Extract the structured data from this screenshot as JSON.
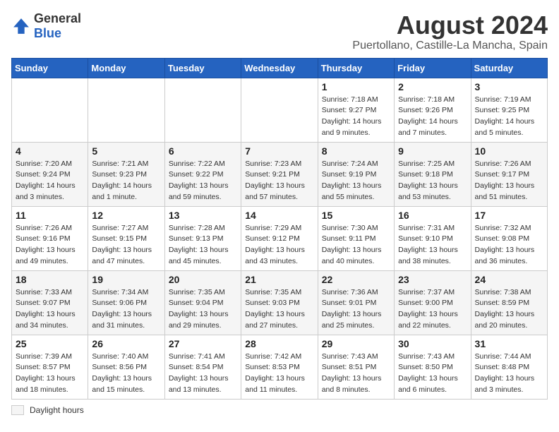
{
  "logo": {
    "general": "General",
    "blue": "Blue"
  },
  "title": "August 2024",
  "subtitle": "Puertollano, Castille-La Mancha, Spain",
  "headers": [
    "Sunday",
    "Monday",
    "Tuesday",
    "Wednesday",
    "Thursday",
    "Friday",
    "Saturday"
  ],
  "weeks": [
    [
      {
        "day": "",
        "info": ""
      },
      {
        "day": "",
        "info": ""
      },
      {
        "day": "",
        "info": ""
      },
      {
        "day": "",
        "info": ""
      },
      {
        "day": "1",
        "info": "Sunrise: 7:18 AM\nSunset: 9:27 PM\nDaylight: 14 hours\nand 9 minutes."
      },
      {
        "day": "2",
        "info": "Sunrise: 7:18 AM\nSunset: 9:26 PM\nDaylight: 14 hours\nand 7 minutes."
      },
      {
        "day": "3",
        "info": "Sunrise: 7:19 AM\nSunset: 9:25 PM\nDaylight: 14 hours\nand 5 minutes."
      }
    ],
    [
      {
        "day": "4",
        "info": "Sunrise: 7:20 AM\nSunset: 9:24 PM\nDaylight: 14 hours\nand 3 minutes."
      },
      {
        "day": "5",
        "info": "Sunrise: 7:21 AM\nSunset: 9:23 PM\nDaylight: 14 hours\nand 1 minute."
      },
      {
        "day": "6",
        "info": "Sunrise: 7:22 AM\nSunset: 9:22 PM\nDaylight: 13 hours\nand 59 minutes."
      },
      {
        "day": "7",
        "info": "Sunrise: 7:23 AM\nSunset: 9:21 PM\nDaylight: 13 hours\nand 57 minutes."
      },
      {
        "day": "8",
        "info": "Sunrise: 7:24 AM\nSunset: 9:19 PM\nDaylight: 13 hours\nand 55 minutes."
      },
      {
        "day": "9",
        "info": "Sunrise: 7:25 AM\nSunset: 9:18 PM\nDaylight: 13 hours\nand 53 minutes."
      },
      {
        "day": "10",
        "info": "Sunrise: 7:26 AM\nSunset: 9:17 PM\nDaylight: 13 hours\nand 51 minutes."
      }
    ],
    [
      {
        "day": "11",
        "info": "Sunrise: 7:26 AM\nSunset: 9:16 PM\nDaylight: 13 hours\nand 49 minutes."
      },
      {
        "day": "12",
        "info": "Sunrise: 7:27 AM\nSunset: 9:15 PM\nDaylight: 13 hours\nand 47 minutes."
      },
      {
        "day": "13",
        "info": "Sunrise: 7:28 AM\nSunset: 9:13 PM\nDaylight: 13 hours\nand 45 minutes."
      },
      {
        "day": "14",
        "info": "Sunrise: 7:29 AM\nSunset: 9:12 PM\nDaylight: 13 hours\nand 43 minutes."
      },
      {
        "day": "15",
        "info": "Sunrise: 7:30 AM\nSunset: 9:11 PM\nDaylight: 13 hours\nand 40 minutes."
      },
      {
        "day": "16",
        "info": "Sunrise: 7:31 AM\nSunset: 9:10 PM\nDaylight: 13 hours\nand 38 minutes."
      },
      {
        "day": "17",
        "info": "Sunrise: 7:32 AM\nSunset: 9:08 PM\nDaylight: 13 hours\nand 36 minutes."
      }
    ],
    [
      {
        "day": "18",
        "info": "Sunrise: 7:33 AM\nSunset: 9:07 PM\nDaylight: 13 hours\nand 34 minutes."
      },
      {
        "day": "19",
        "info": "Sunrise: 7:34 AM\nSunset: 9:06 PM\nDaylight: 13 hours\nand 31 minutes."
      },
      {
        "day": "20",
        "info": "Sunrise: 7:35 AM\nSunset: 9:04 PM\nDaylight: 13 hours\nand 29 minutes."
      },
      {
        "day": "21",
        "info": "Sunrise: 7:35 AM\nSunset: 9:03 PM\nDaylight: 13 hours\nand 27 minutes."
      },
      {
        "day": "22",
        "info": "Sunrise: 7:36 AM\nSunset: 9:01 PM\nDaylight: 13 hours\nand 25 minutes."
      },
      {
        "day": "23",
        "info": "Sunrise: 7:37 AM\nSunset: 9:00 PM\nDaylight: 13 hours\nand 22 minutes."
      },
      {
        "day": "24",
        "info": "Sunrise: 7:38 AM\nSunset: 8:59 PM\nDaylight: 13 hours\nand 20 minutes."
      }
    ],
    [
      {
        "day": "25",
        "info": "Sunrise: 7:39 AM\nSunset: 8:57 PM\nDaylight: 13 hours\nand 18 minutes."
      },
      {
        "day": "26",
        "info": "Sunrise: 7:40 AM\nSunset: 8:56 PM\nDaylight: 13 hours\nand 15 minutes."
      },
      {
        "day": "27",
        "info": "Sunrise: 7:41 AM\nSunset: 8:54 PM\nDaylight: 13 hours\nand 13 minutes."
      },
      {
        "day": "28",
        "info": "Sunrise: 7:42 AM\nSunset: 8:53 PM\nDaylight: 13 hours\nand 11 minutes."
      },
      {
        "day": "29",
        "info": "Sunrise: 7:43 AM\nSunset: 8:51 PM\nDaylight: 13 hours\nand 8 minutes."
      },
      {
        "day": "30",
        "info": "Sunrise: 7:43 AM\nSunset: 8:50 PM\nDaylight: 13 hours\nand 6 minutes."
      },
      {
        "day": "31",
        "info": "Sunrise: 7:44 AM\nSunset: 8:48 PM\nDaylight: 13 hours\nand 3 minutes."
      }
    ]
  ],
  "legend": {
    "label": "Daylight hours"
  }
}
